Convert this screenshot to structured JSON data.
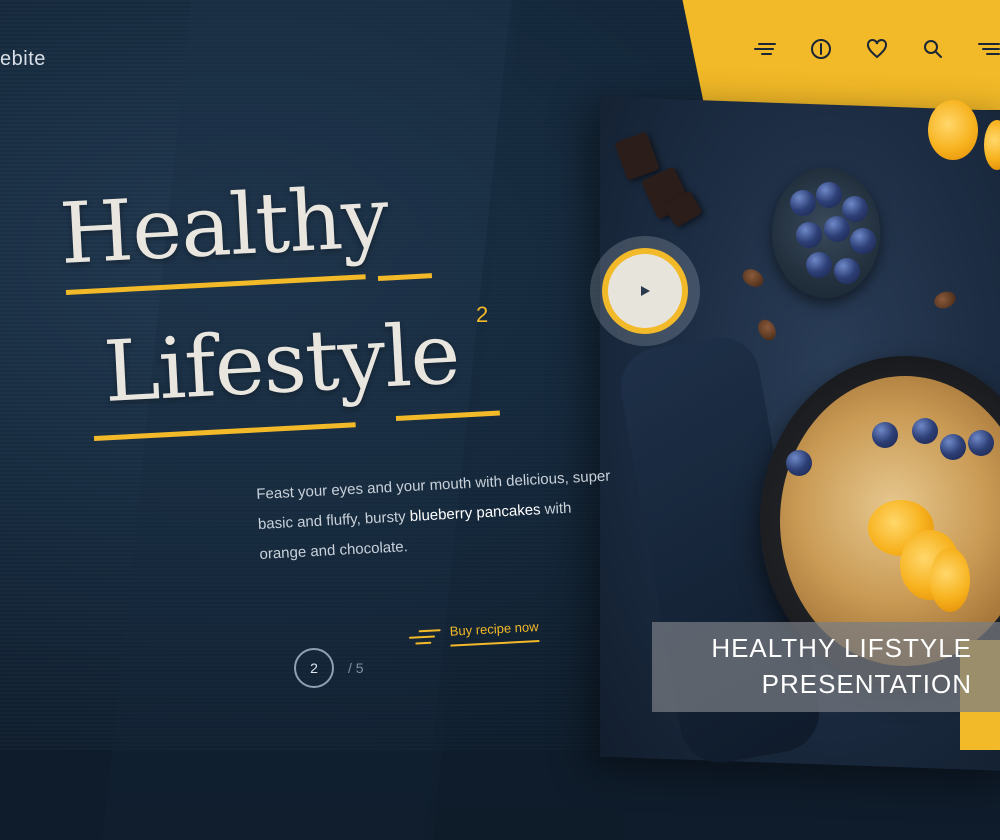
{
  "header": {
    "logo_text": "ebite",
    "nav_icons": [
      "menu-lines-icon",
      "coin-icon",
      "heart-icon",
      "search-icon",
      "hamburger-icon"
    ]
  },
  "hero": {
    "title_line1": "Healthy",
    "title_line2": "Lifestyle",
    "title_superscript": "2",
    "description_part1": "Feast your eyes and your mouth with delicious, super basic and fluffy, bursty ",
    "description_highlight": "blueberry pancakes",
    "description_part2": " with orange and chocolate."
  },
  "pagination": {
    "current": "2",
    "total": "/ 5"
  },
  "cta": {
    "buy_label": "Buy recipe now"
  },
  "overlay_caption": {
    "line1": "HEALTHY LIFSTYLE",
    "line2": "PRESENTATION"
  },
  "colors": {
    "accent": "#f2b928",
    "background": "#162a3e",
    "text": "#e9e6df"
  }
}
